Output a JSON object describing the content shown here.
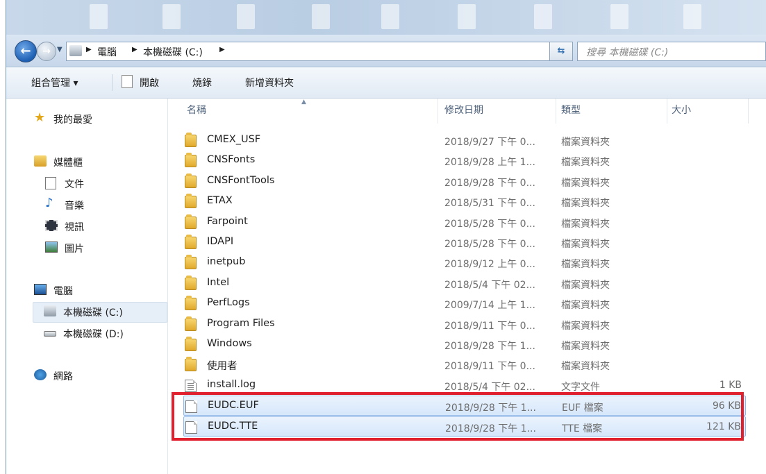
{
  "address": {
    "crumbs": [
      "電腦",
      "本機磁碟 (C:)"
    ],
    "search_placeholder": "搜尋 本機磁碟 (C:)"
  },
  "toolbar": {
    "organize": "組合管理 ▾",
    "open": "開啟",
    "burn": "燒錄",
    "new_folder": "新增資料夾"
  },
  "nav": {
    "favorites": "我的最愛",
    "libraries": "媒體櫃",
    "documents": "文件",
    "music": "音樂",
    "videos": "視訊",
    "pictures": "圖片",
    "computer": "電腦",
    "drive_c": "本機磁碟 (C:)",
    "drive_d": "本機磁碟 (D:)",
    "network": "網路"
  },
  "columns": {
    "name": "名稱",
    "date": "修改日期",
    "type": "類型",
    "size": "大小"
  },
  "files": [
    {
      "name": "CMEX_USF",
      "date": "2018/9/27 下午 0...",
      "type": "檔案資料夾",
      "size": "",
      "kind": "folder"
    },
    {
      "name": "CNSFonts",
      "date": "2018/9/28 上午 1...",
      "type": "檔案資料夾",
      "size": "",
      "kind": "folder"
    },
    {
      "name": "CNSFontTools",
      "date": "2018/9/28 下午 0...",
      "type": "檔案資料夾",
      "size": "",
      "kind": "folder"
    },
    {
      "name": "ETAX",
      "date": "2018/5/31 下午 0...",
      "type": "檔案資料夾",
      "size": "",
      "kind": "folder"
    },
    {
      "name": "Farpoint",
      "date": "2018/5/28 下午 0...",
      "type": "檔案資料夾",
      "size": "",
      "kind": "folder"
    },
    {
      "name": "IDAPI",
      "date": "2018/5/28 下午 0...",
      "type": "檔案資料夾",
      "size": "",
      "kind": "folder"
    },
    {
      "name": "inetpub",
      "date": "2018/9/12 上午 0...",
      "type": "檔案資料夾",
      "size": "",
      "kind": "folder"
    },
    {
      "name": "Intel",
      "date": "2018/5/4 下午 02...",
      "type": "檔案資料夾",
      "size": "",
      "kind": "folder"
    },
    {
      "name": "PerfLogs",
      "date": "2009/7/14 上午 1...",
      "type": "檔案資料夾",
      "size": "",
      "kind": "folder"
    },
    {
      "name": "Program Files",
      "date": "2018/9/11 下午 0...",
      "type": "檔案資料夾",
      "size": "",
      "kind": "folder"
    },
    {
      "name": "Windows",
      "date": "2018/9/28 下午 1...",
      "type": "檔案資料夾",
      "size": "",
      "kind": "folder"
    },
    {
      "name": "使用者",
      "date": "2018/9/11 下午 0...",
      "type": "檔案資料夾",
      "size": "",
      "kind": "folder"
    },
    {
      "name": "install.log",
      "date": "2018/5/4 下午 02...",
      "type": "文字文件",
      "size": "1 KB",
      "kind": "text"
    },
    {
      "name": "EUDC.EUF",
      "date": "2018/9/28 下午 1...",
      "type": "EUF 檔案",
      "size": "96 KB",
      "kind": "file"
    },
    {
      "name": "EUDC.TTE",
      "date": "2018/9/28 下午 1...",
      "type": "TTE 檔案",
      "size": "121 KB",
      "kind": "file"
    }
  ],
  "colors": {
    "highlight": "#e0202c",
    "selection": "#d6e7fb",
    "folder": "#e9bc48"
  }
}
